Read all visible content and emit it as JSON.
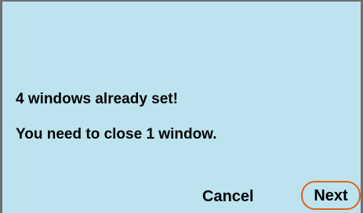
{
  "dialog": {
    "message_line1": "4 windows already set!",
    "message_line2": "You need to close 1 window."
  },
  "buttons": {
    "cancel_label": "Cancel",
    "next_label": "Next"
  },
  "colors": {
    "background": "#bde3ef",
    "border": "#6f6f6f",
    "highlight": "#e0611a"
  }
}
